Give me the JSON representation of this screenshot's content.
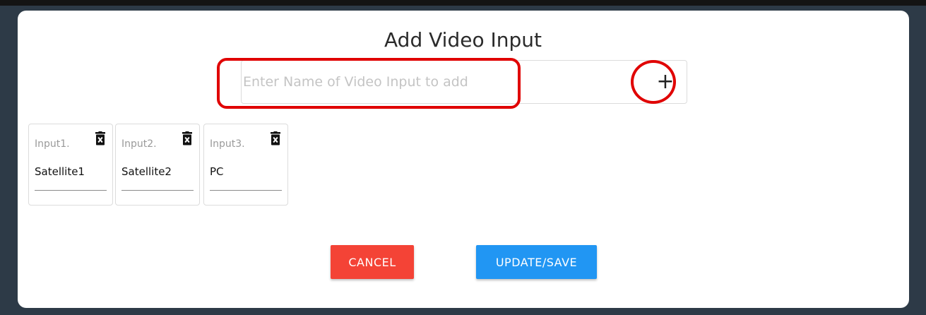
{
  "dialog": {
    "title": "Add Video Input"
  },
  "add_input": {
    "placeholder": "Enter Name of Video Input to add",
    "value": "",
    "add_button_label": "+"
  },
  "inputs": [
    {
      "label": "Input1.",
      "value": "Satellite1"
    },
    {
      "label": "Input2.",
      "value": "Satellite2"
    },
    {
      "label": "Input3.",
      "value": "PC"
    }
  ],
  "buttons": {
    "cancel": "CANCEL",
    "save": "UPDATE/SAVE"
  },
  "colors": {
    "backdrop": "#2d3a47",
    "cancel": "#f44336",
    "save": "#2196f3",
    "annotation": "#e00000"
  },
  "icons": {
    "delete": "trash-icon"
  }
}
